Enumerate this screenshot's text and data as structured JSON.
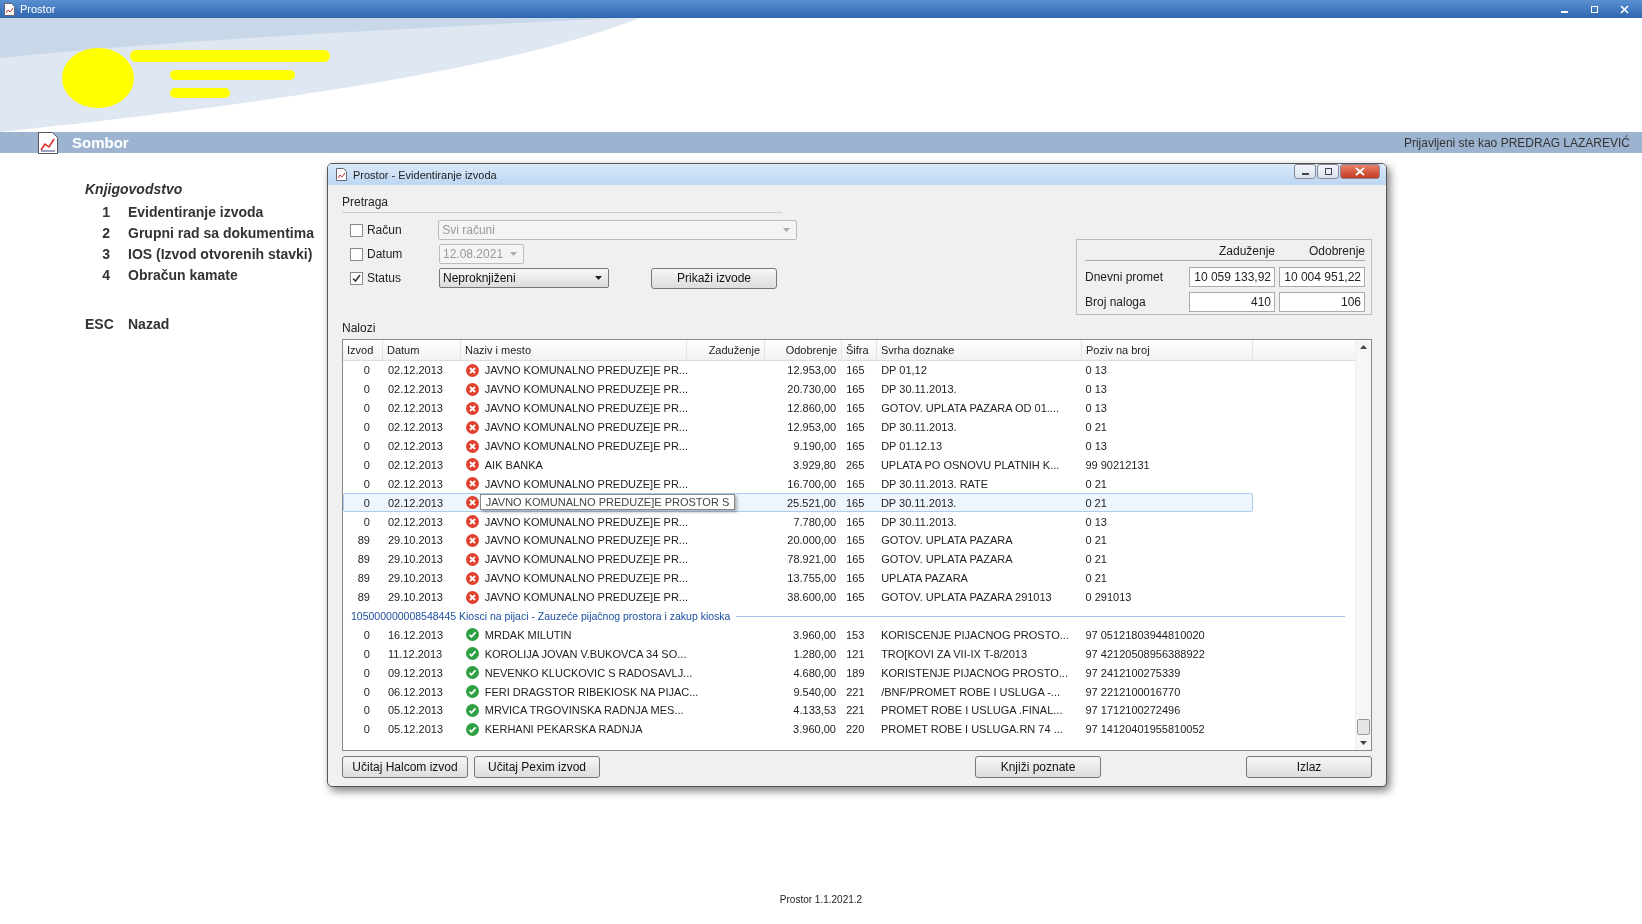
{
  "app_title": "Prostor",
  "location": "Sombor",
  "user_info": "Prijavljeni ste kao PREDRAG LAZAREVIĆ",
  "menu": {
    "heading": "Knjigovodstvo",
    "items": [
      {
        "key": "1",
        "label": "Evidentiranje izvoda"
      },
      {
        "key": "2",
        "label": "Grupni rad sa dokumentima"
      },
      {
        "key": "3",
        "label": "IOS (Izvod otvorenih stavki)"
      },
      {
        "key": "4",
        "label": "Obračun kamate"
      }
    ],
    "back": {
      "key": "ESC",
      "label": "Nazad"
    }
  },
  "dialog": {
    "title": "Prostor - Evidentiranje izvoda",
    "search": {
      "heading": "Pretraga",
      "filters": [
        {
          "label": "Račun",
          "checked": false,
          "value": "Svi računi"
        },
        {
          "label": "Datum",
          "checked": false,
          "value": "12.08.2021"
        },
        {
          "label": "Status",
          "checked": true,
          "value": "Neproknjiženi"
        }
      ],
      "button": "Prikaži izvode"
    },
    "summary": {
      "columns": [
        "Zaduženje",
        "Odobrenje"
      ],
      "rows": [
        {
          "label": "Dnevni promet",
          "values": [
            "10 059 133,92",
            "10 004 951,22"
          ]
        },
        {
          "label": "Broj naloga",
          "values": [
            "410",
            "106"
          ]
        }
      ]
    },
    "list_label": "Nalozi",
    "table": {
      "columns": [
        "Izvod",
        "Datum",
        "Naziv i mesto",
        "Zaduženje",
        "Odobrenje",
        "Šifra",
        "Svrha doznake",
        "Poziv na broj"
      ],
      "rows": [
        {
          "kind": "error_row",
          "selected": false,
          "izvod": "0",
          "datum": "02.12.2013",
          "naziv": "JAVNO KOMUNALNO PREDUZE]E PR...",
          "odobrenje": "12.953,00",
          "sifra": "165",
          "svrha": "DP 01,12",
          "poziv": "0 13"
        },
        {
          "kind": "error_row",
          "selected": false,
          "izvod": "0",
          "datum": "02.12.2013",
          "naziv": "JAVNO KOMUNALNO PREDUZE]E PR...",
          "odobrenje": "20.730,00",
          "sifra": "165",
          "svrha": "DP 30.11.2013.",
          "poziv": "0 13"
        },
        {
          "kind": "error_row",
          "selected": false,
          "izvod": "0",
          "datum": "02.12.2013",
          "naziv": "JAVNO KOMUNALNO PREDUZE]E PR...",
          "odobrenje": "12.860,00",
          "sifra": "165",
          "svrha": "GOTOV. UPLATA PAZARA OD 01....",
          "poziv": "0 13"
        },
        {
          "kind": "error_row",
          "selected": false,
          "izvod": "0",
          "datum": "02.12.2013",
          "naziv": "JAVNO KOMUNALNO PREDUZE]E PR...",
          "odobrenje": "12.953,00",
          "sifra": "165",
          "svrha": "DP 30.11.2013.",
          "poziv": "0 21"
        },
        {
          "kind": "error_row",
          "selected": false,
          "izvod": "0",
          "datum": "02.12.2013",
          "naziv": "JAVNO KOMUNALNO PREDUZE]E PR...",
          "odobrenje": "9.190,00",
          "sifra": "165",
          "svrha": "DP 01.12.13",
          "poziv": "0 13"
        },
        {
          "kind": "error_row",
          "selected": false,
          "izvod": "0",
          "datum": "02.12.2013",
          "naziv": "AIK BANKA",
          "odobrenje": "3.929,80",
          "sifra": "265",
          "svrha": "UPLATA PO OSNOVU PLATNIH K...",
          "poziv": "99 90212131"
        },
        {
          "kind": "error_row",
          "selected": false,
          "izvod": "0",
          "datum": "02.12.2013",
          "naziv": "JAVNO KOMUNALNO PREDUZE]E PR...",
          "odobrenje": "16.700,00",
          "sifra": "165",
          "svrha": "DP 30.11.2013. RATE",
          "poziv": "0 21"
        },
        {
          "kind": "error_row",
          "selected": true,
          "izvod": "0",
          "datum": "02.12.2013",
          "tooltip": "JAVNO KOMUNALNO PREDUZE]E PROSTOR S",
          "odobrenje": "25.521,00",
          "sifra": "165",
          "svrha": "DP 30.11.2013.",
          "poziv": "0 21"
        },
        {
          "kind": "error_row",
          "selected": false,
          "izvod": "0",
          "datum": "02.12.2013",
          "naziv": "JAVNO KOMUNALNO PREDUZE]E PR...",
          "odobrenje": "7.780,00",
          "sifra": "165",
          "svrha": "DP 30.11.2013.",
          "poziv": "0 13"
        },
        {
          "kind": "error_row",
          "selected": false,
          "izvod": "89",
          "datum": "29.10.2013",
          "naziv": "JAVNO KOMUNALNO PREDUZE]E PR...",
          "odobrenje": "20.000,00",
          "sifra": "165",
          "svrha": "GOTOV. UPLATA PAZARA",
          "poziv": "0 21"
        },
        {
          "kind": "error_row",
          "selected": false,
          "izvod": "89",
          "datum": "29.10.2013",
          "naziv": "JAVNO KOMUNALNO PREDUZE]E PR...",
          "odobrenje": "78.921,00",
          "sifra": "165",
          "svrha": "GOTOV. UPLATA PAZARA",
          "poziv": "0 21"
        },
        {
          "kind": "error_row",
          "selected": false,
          "izvod": "89",
          "datum": "29.10.2013",
          "naziv": "JAVNO KOMUNALNO PREDUZE]E PR...",
          "odobrenje": "13.755,00",
          "sifra": "165",
          "svrha": "UPLATA PAZARA",
          "poziv": "0 21"
        },
        {
          "kind": "error_row",
          "selected": false,
          "izvod": "89",
          "datum": "29.10.2013",
          "naziv": "JAVNO KOMUNALNO PREDUZE]E PR...",
          "odobrenje": "38.600,00",
          "sifra": "165",
          "svrha": "GOTOV. UPLATA PAZARA 291013",
          "poziv": "0 291013"
        },
        {
          "kind": "group",
          "label": "105000000008548445 Kiosci na pijaci - Zauzeće pijačnog prostora i zakup kioska"
        },
        {
          "kind": "ok_row",
          "selected": false,
          "izvod": "0",
          "datum": "16.12.2013",
          "naziv": "MRDAK MILUTIN",
          "odobrenje": "3.960,00",
          "sifra": "153",
          "svrha": "KORISCENJE PIJACNOG PROSTO...",
          "poziv": "97 05121803944810020"
        },
        {
          "kind": "ok_row",
          "selected": false,
          "izvod": "0",
          "datum": "11.12.2013",
          "naziv": "KOROLIJA JOVAN V.BUKOVCA 34 SO...",
          "odobrenje": "1.280,00",
          "sifra": "121",
          "svrha": "TRO[KOVI ZA VII-IX T-8/2013",
          "poziv": "97 42120508956388922"
        },
        {
          "kind": "ok_row",
          "selected": false,
          "izvod": "0",
          "datum": "09.12.2013",
          "naziv": "NEVENKO KLUCKOVIC S RADOSAVLJ...",
          "odobrenje": "4.680,00",
          "sifra": "189",
          "svrha": "KORISTENJE PIJACNOG PROSTO...",
          "poziv": "97 2412100275339"
        },
        {
          "kind": "ok_row",
          "selected": false,
          "izvod": "0",
          "datum": "06.12.2013",
          "naziv": "FERI DRAGSTOR RIBEKIOSK NA PIJAC...",
          "odobrenje": "9.540,00",
          "sifra": "221",
          "svrha": "/BNF/PROMET ROBE I USLUGA -...",
          "poziv": "97 2212100016770"
        },
        {
          "kind": "ok_row",
          "selected": false,
          "izvod": "0",
          "datum": "05.12.2013",
          "naziv": "MRVICA TRGOVINSKA RADNJA MES...",
          "odobrenje": "4.133,53",
          "sifra": "221",
          "svrha": "PROMET ROBE I USLUGA .FINAL...",
          "poziv": "97 1712100272496"
        },
        {
          "kind": "ok_row",
          "selected": false,
          "izvod": "0",
          "datum": "05.12.2013",
          "naziv": "KERHANI PEKARSKA RADNJA",
          "odobrenje": "3.960,00",
          "sifra": "220",
          "svrha": "PROMET ROBE I USLUGA.RN 74 ...",
          "poziv": "97 14120401955810052"
        }
      ]
    },
    "left_buttons": [
      "Učitaj Halcom izvod",
      "Učitaj Pexim izvod"
    ],
    "center_button": "Knjiži poznate",
    "right_button": "Izlaz"
  },
  "footer": "Prostor 1.1.2021.2"
}
